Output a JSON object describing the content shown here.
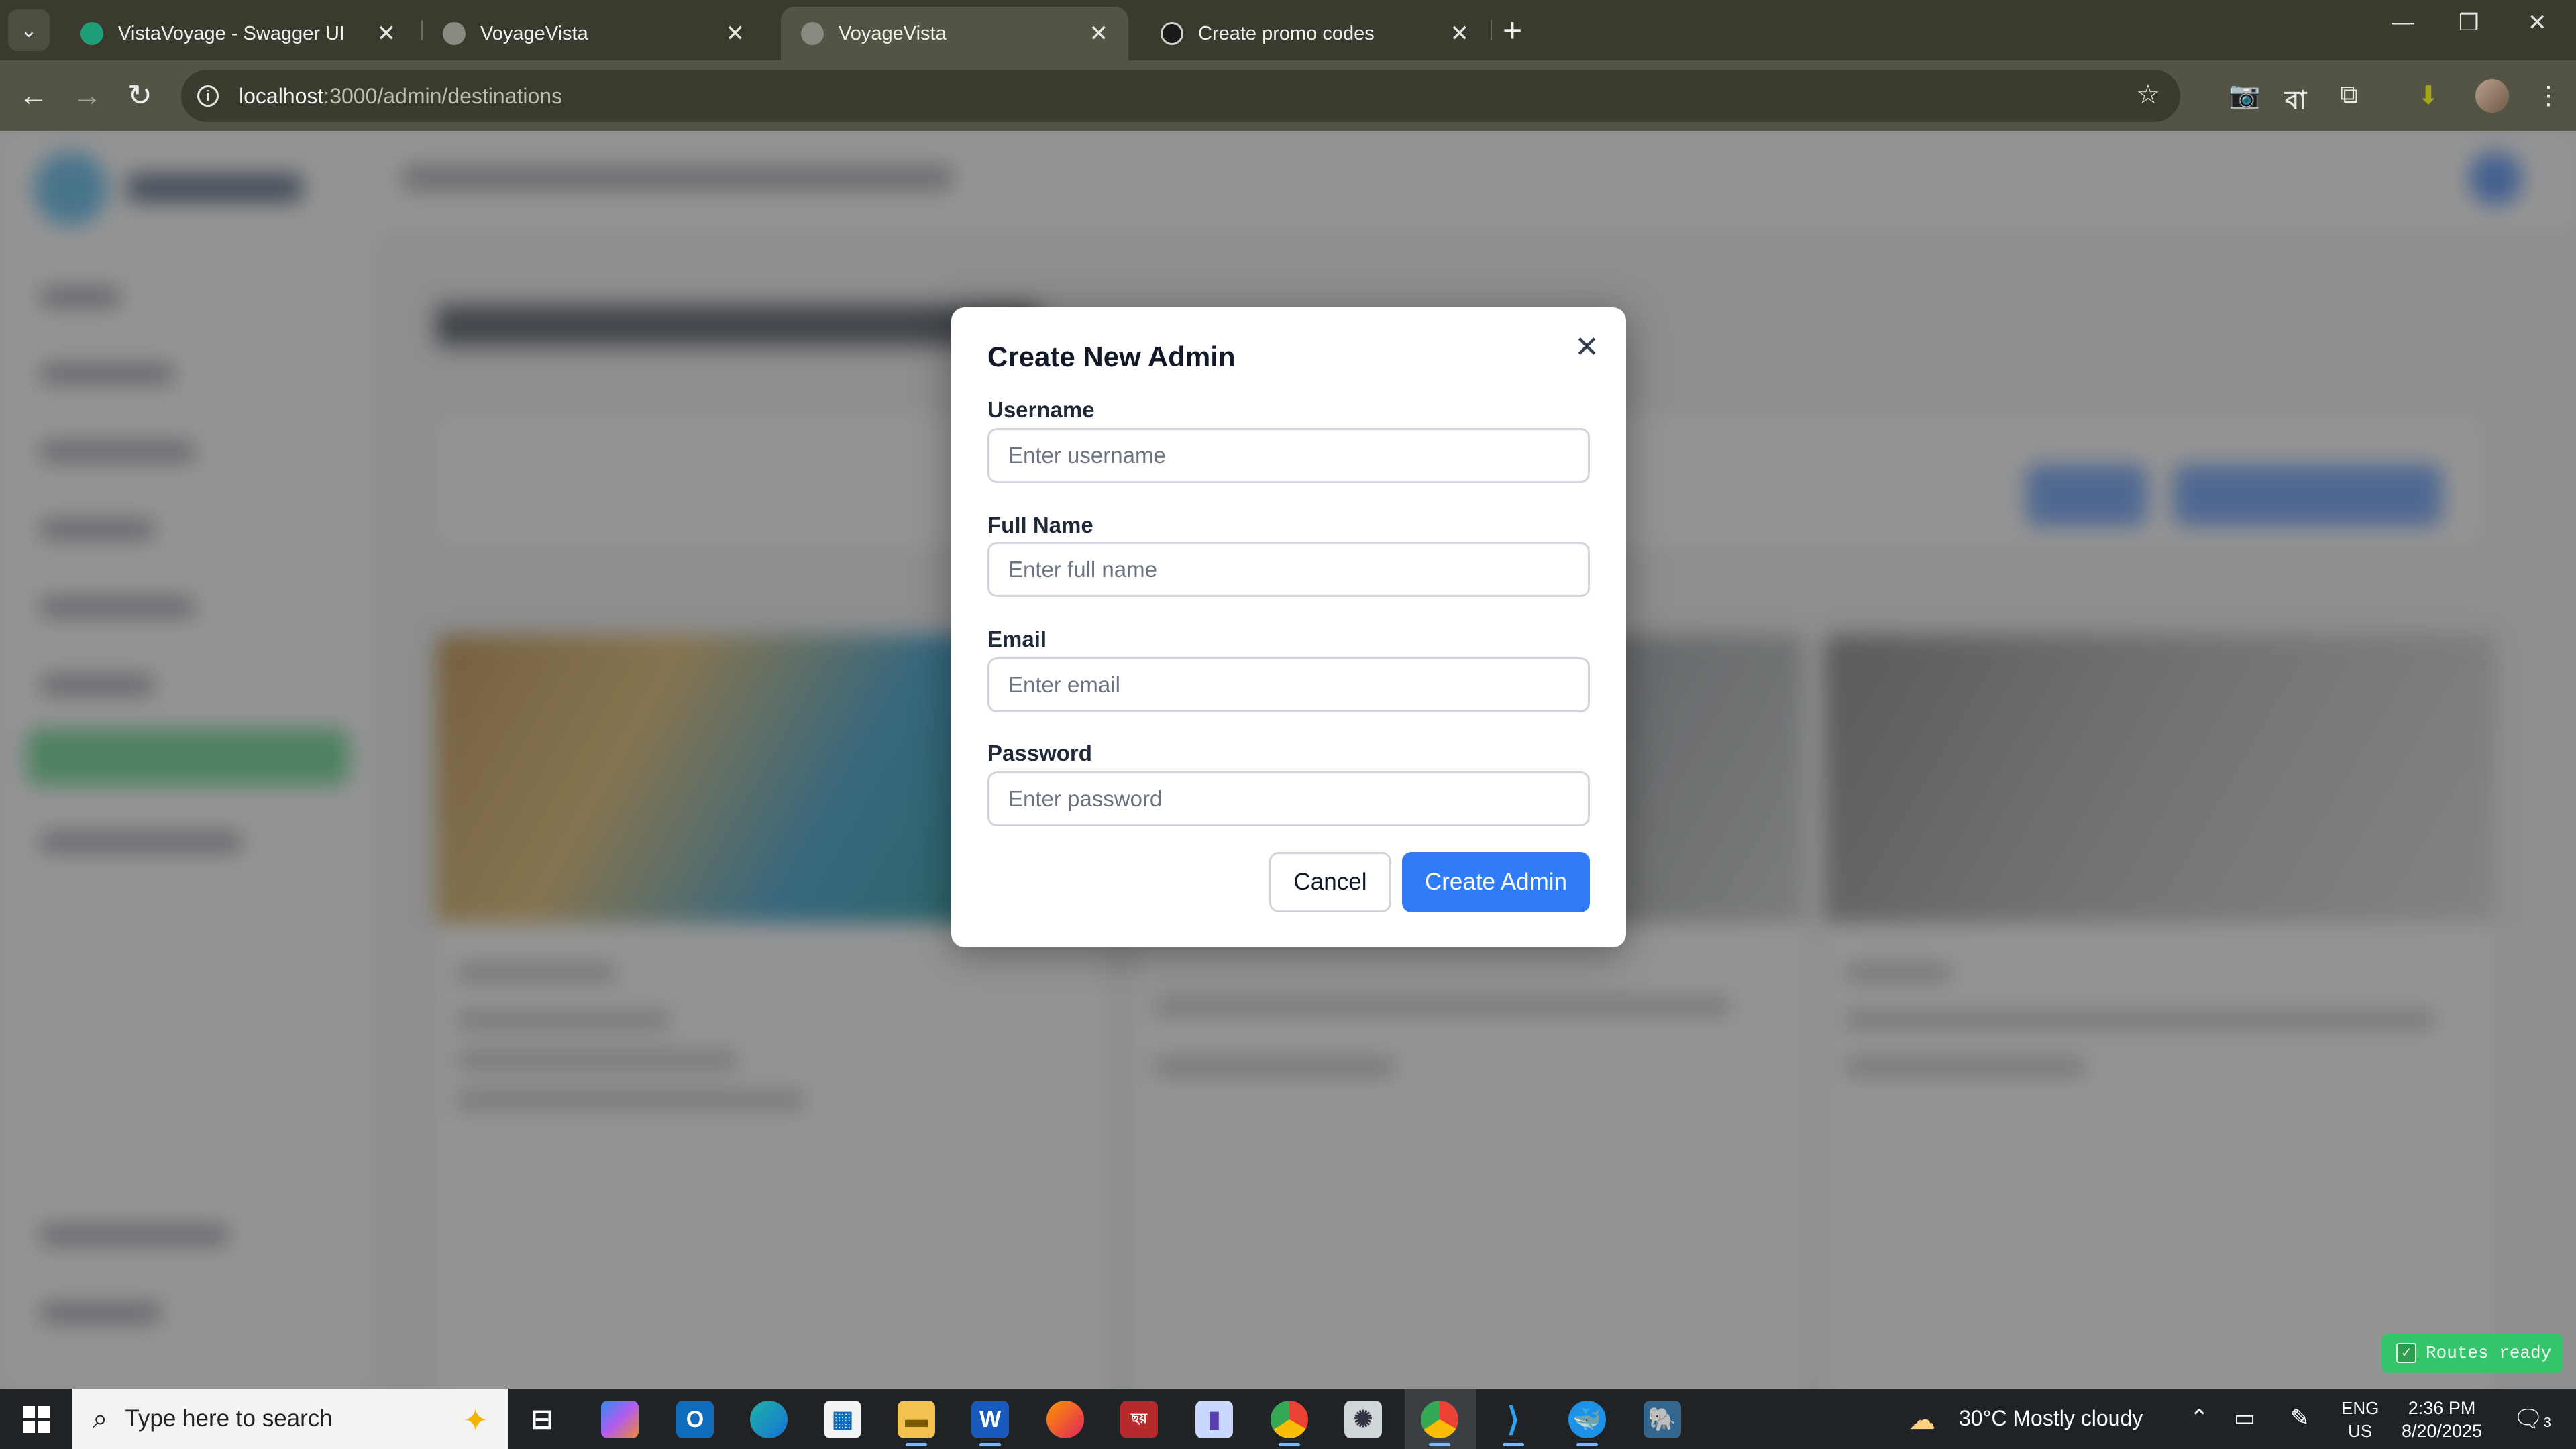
{
  "browser": {
    "tabs": [
      {
        "title": "VistaVoyage - Swagger UI",
        "active": false
      },
      {
        "title": "VoyageVista",
        "active": false
      },
      {
        "title": "VoyageVista",
        "active": true
      },
      {
        "title": "Create promo codes",
        "active": false
      }
    ],
    "url_host": "localhost",
    "url_path": ":3000/admin/destinations"
  },
  "modal": {
    "title": "Create New Admin",
    "fields": [
      {
        "label": "Username",
        "placeholder": "Enter username"
      },
      {
        "label": "Full Name",
        "placeholder": "Enter full name"
      },
      {
        "label": "Email",
        "placeholder": "Enter email"
      },
      {
        "label": "Password",
        "placeholder": "Enter password"
      }
    ],
    "cancel_label": "Cancel",
    "submit_label": "Create Admin"
  },
  "toast": {
    "text": "Routes ready"
  },
  "taskbar": {
    "search_placeholder": "Type here to search",
    "weather": "30°C  Mostly cloudy",
    "lang_line1": "ENG",
    "lang_line2": "US",
    "time": "2:36 PM",
    "date": "8/20/2025",
    "notification_count": "3"
  },
  "colors": {
    "primary": "#2f7cf6",
    "toast": "#34c46a",
    "chrome_dark": "#3a3a2f"
  }
}
